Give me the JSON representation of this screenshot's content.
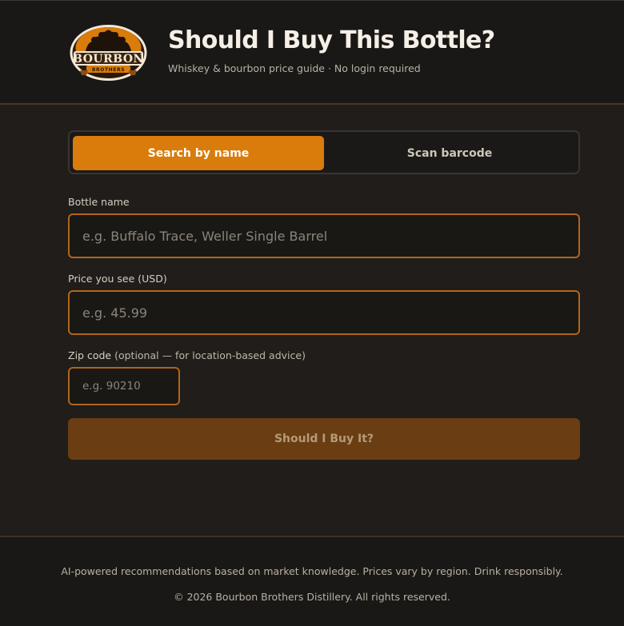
{
  "header": {
    "logo_text": "BOURBON BROTHERS",
    "title": "Should I Buy This Bottle?",
    "subtitle": "Whiskey & bourbon price guide · No login required"
  },
  "tabs": [
    {
      "label": "Search by name",
      "active": true
    },
    {
      "label": "Scan barcode",
      "active": false
    }
  ],
  "form": {
    "bottle_name": {
      "label": "Bottle name",
      "placeholder": "e.g. Buffalo Trace, Weller Single Barrel",
      "value": ""
    },
    "price": {
      "label": "Price you see (USD)",
      "placeholder": "e.g. 45.99",
      "value": ""
    },
    "zip": {
      "label": "Zip code",
      "label_note": "(optional — for location-based advice)",
      "placeholder": "e.g. 90210",
      "value": ""
    },
    "submit_label": "Should I Buy It?"
  },
  "footer": {
    "note": "AI-powered recommendations based on market knowledge. Prices vary by region. Drink responsibly.",
    "copyright": "© 2026 Bourbon Brothers Distillery. All rights reserved."
  },
  "colors": {
    "accent": "#d97c0c",
    "submit_disabled": "#6a3e12",
    "input_border": "#b0651c",
    "background": "#1f1c19"
  },
  "icons": {
    "logo": "bourbon-brothers-logo"
  }
}
